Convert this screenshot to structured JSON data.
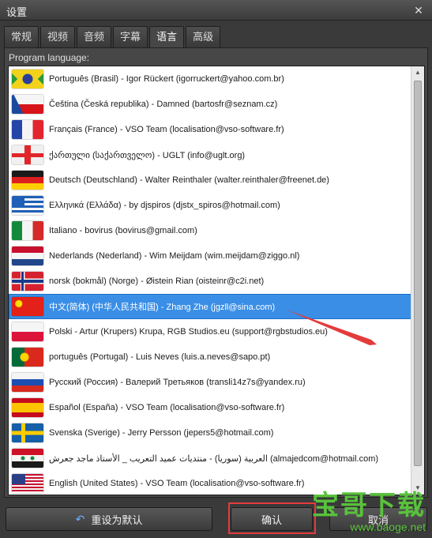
{
  "window": {
    "title": "设置",
    "close_glyph": "✕"
  },
  "tabs": [
    {
      "label": "常规"
    },
    {
      "label": "视频"
    },
    {
      "label": "音频"
    },
    {
      "label": "字幕"
    },
    {
      "label": "语言",
      "active": true
    },
    {
      "label": "高级"
    }
  ],
  "panel": {
    "label": "Program language:"
  },
  "languages": [
    {
      "flag": "brazil-flag",
      "label": "Português (Brasil) - Igor Rückert (igorruckert@yahoo.com.br)"
    },
    {
      "flag": "czech-flag",
      "label": "Čeština (Česká republika) - Damned (bartosfr@seznam.cz)"
    },
    {
      "flag": "france-flag",
      "label": "Français (France) - VSO Team (localisation@vso-software.fr)"
    },
    {
      "flag": "georgia-flag",
      "label": "ქართული (საქართველო) - UGLT (info@uglt.org)"
    },
    {
      "flag": "germany-flag",
      "label": "Deutsch (Deutschland) - Walter Reinthaler (walter.reinthaler@freenet.de)"
    },
    {
      "flag": "greece-flag",
      "label": "Ελληνικά (Ελλάδα) - by djspiros (djstx_spiros@hotmail.com)"
    },
    {
      "flag": "italy-flag",
      "label": "Italiano - bovirus (bovirus@gmail.com)"
    },
    {
      "flag": "netherlands-flag",
      "label": "Nederlands (Nederland) - Wim Meijdam (wim.meijdam@ziggo.nl)"
    },
    {
      "flag": "norway-flag",
      "label": "norsk (bokmål) (Norge) - Øistein Rian (oisteinr@c2i.net)"
    },
    {
      "flag": "china-flag",
      "label": "中文(简体) (中华人民共和国) - Zhang Zhe (jgzll@sina.com)",
      "selected": true
    },
    {
      "flag": "poland-flag",
      "label": "Polski - Artur (Krupers) Krupa, RGB Studios.eu (support@rgbstudios.eu)"
    },
    {
      "flag": "portugal-flag",
      "label": "português (Portugal) - Luis Neves (luis.a.neves@sapo.pt)"
    },
    {
      "flag": "russia-flag",
      "label": "Русский (Россия) - Валерий Третьяков (transli14z7s@yandex.ru)"
    },
    {
      "flag": "spain-flag",
      "label": "Español (España) - VSO Team (localisation@vso-software.fr)"
    },
    {
      "flag": "sweden-flag",
      "label": "Svenska (Sverige) - Jerry Persson (jepers5@hotmail.com)"
    },
    {
      "flag": "syria-flag",
      "label": "العربية (سوريا) - منتديات عميد التعريب _ الأستاذ ماجد جعرش (almajedcom@hotmail.com)"
    },
    {
      "flag": "usa-flag",
      "label": "English (United States) - VSO Team (localisation@vso-software.fr)"
    }
  ],
  "footer": {
    "reset_label": "重设为默认",
    "ok_label": "确认",
    "cancel_label": "取消"
  },
  "watermark": {
    "main": "宝哥下载",
    "sub": "www.baoge.net"
  },
  "colors": {
    "selection": "#3a8ee6",
    "annotation": "#e43b3b",
    "watermark": "#59c23c"
  }
}
